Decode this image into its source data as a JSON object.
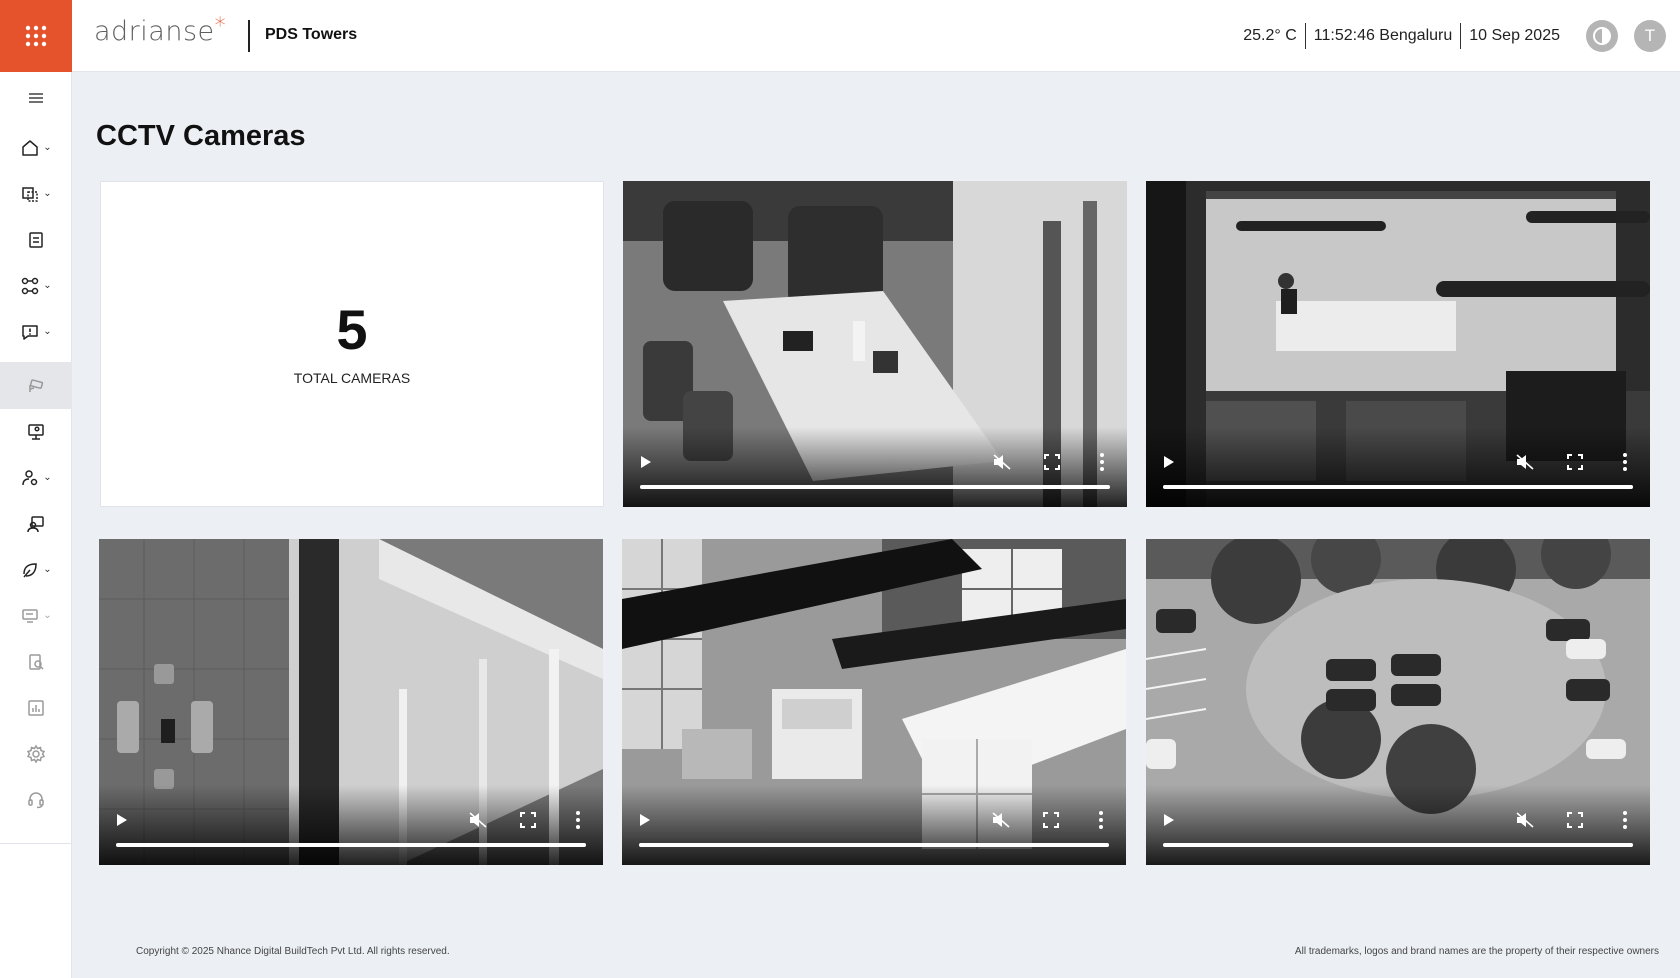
{
  "header": {
    "brand": "adrianse",
    "brand_mark": "*",
    "site": "PDS Towers",
    "temperature": "25.2° C",
    "time": "11:52:46 Bengaluru",
    "date": "10 Sep 2025",
    "theme_icon": "contrast-icon",
    "user_initial": "T",
    "apps_icon": "apps-grid-icon",
    "accent_color": "#e5532d"
  },
  "sidebar": {
    "toggle_icon": "hamburger-icon",
    "items": [
      {
        "icon": "home-icon",
        "expandable": true
      },
      {
        "icon": "floor-plan-icon",
        "expandable": true
      },
      {
        "icon": "document-icon",
        "expandable": false
      },
      {
        "icon": "devices-icon",
        "expandable": true
      },
      {
        "icon": "alert-message-icon",
        "expandable": true
      },
      {
        "icon": "cctv-icon",
        "expandable": false,
        "active": true
      },
      {
        "icon": "monitor-user-icon",
        "expandable": false
      },
      {
        "icon": "user-settings-icon",
        "expandable": true
      },
      {
        "icon": "visitor-icon",
        "expandable": false
      },
      {
        "icon": "energy-icon",
        "expandable": true
      },
      {
        "icon": "presentation-icon",
        "expandable": true
      },
      {
        "icon": "clipboard-search-icon",
        "expandable": false
      },
      {
        "icon": "reports-chart-icon",
        "expandable": false
      },
      {
        "icon": "gear-icon",
        "expandable": false
      },
      {
        "icon": "support-headset-icon",
        "expandable": false
      }
    ]
  },
  "main": {
    "title": "CCTV Cameras",
    "total_cameras": "5",
    "total_label": "TOTAL CAMERAS",
    "cameras": [
      {
        "scene": "open office desks",
        "progress": 1.0
      },
      {
        "scene": "glass office with worker",
        "progress": 1.0
      },
      {
        "scene": "lobby atrium",
        "progress": 1.0
      },
      {
        "scene": "storage room",
        "progress": 1.0
      },
      {
        "scene": "parking lot",
        "progress": 1.0
      }
    ]
  },
  "footer": {
    "copyright": "Copyright © 2025 Nhance Digital BuildTech Pvt Ltd. All rights reserved.",
    "trademark": "All trademarks, logos and brand names are the property of their respective owners"
  }
}
